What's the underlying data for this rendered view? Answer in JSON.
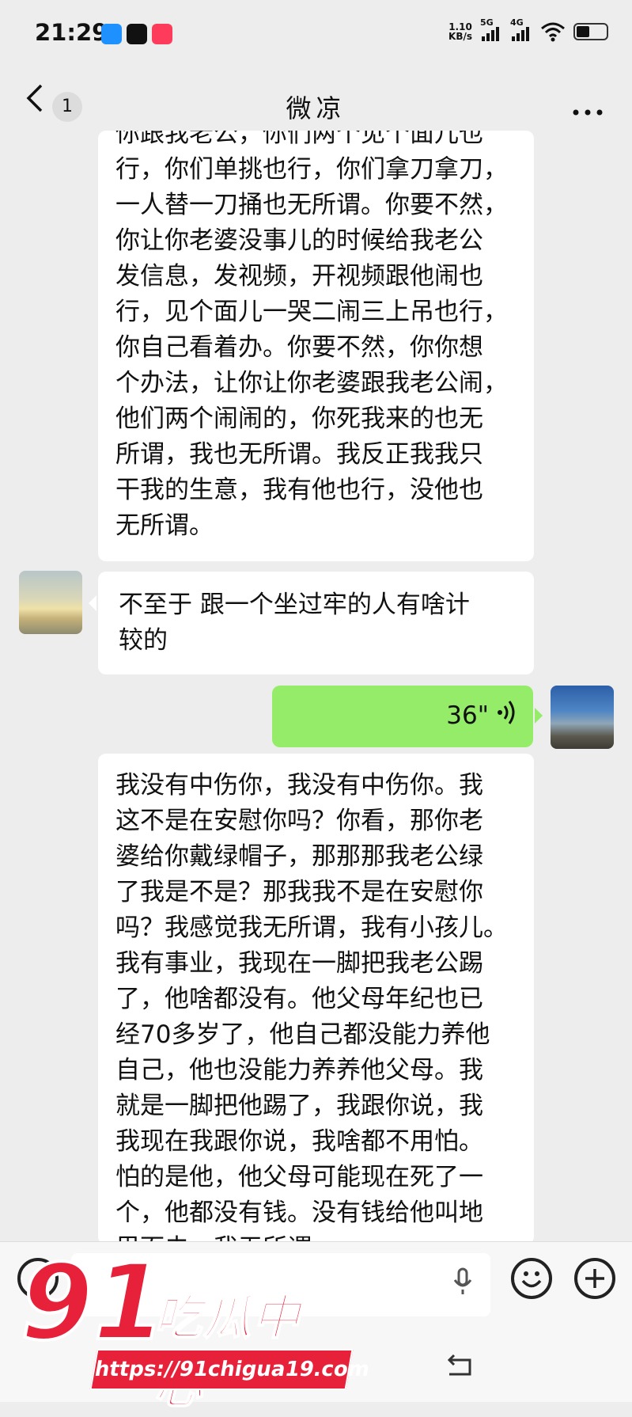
{
  "status_bar": {
    "time": "21:29",
    "net_speed": "1.10",
    "net_unit": "KB/s",
    "sig1": "5G",
    "sig2": "4G"
  },
  "nav": {
    "back_icon": "chevron-left-icon",
    "unread_count": "1",
    "title": "微凉",
    "more_icon": "ellipsis-icon"
  },
  "messages": [
    {
      "side": "left",
      "lines": [
        "你跟我老公，你们两个见个面儿也",
        "行，你们单挑也行，你们拿刀拿刀，",
        "一人替一刀捅也无所谓。你要不然，",
        "你让你老婆没事儿的时候给我老公",
        "发信息，发视频，开视频跟他闹也",
        "行，见个面儿一哭二闹三上吊也行，",
        "你自己看着办。你要不然，你你想",
        "个办法，让你让你老婆跟我老公闹，",
        "他们两个闹闹的，你死我来的也无",
        "所谓，我也无所谓。我反正我我只",
        "干我的生意，我有他也行，没他也",
        "无所谓。"
      ]
    },
    {
      "side": "left",
      "lines": [
        "不至于 跟一个坐过牢的人有啥计",
        "较的"
      ]
    },
    {
      "side": "right",
      "type": "voice",
      "duration": "36\""
    },
    {
      "side": "left",
      "lines": [
        "我没有中伤你，我没有中伤你。我",
        "这不是在安慰你吗？你看，那你老",
        "婆给你戴绿帽子，那那那我老公绿",
        "了我是不是？那我我不是在安慰你",
        "吗？我感觉我无所谓，我有小孩儿。",
        "我有事业，我现在一脚把我老公踢",
        "了，他啥都没有。他父母年纪也已",
        "经70多岁了，他自己都没能力养他",
        "自己，他也没能力养养他父母。我",
        "就是一脚把他踢了，我跟你说，我",
        "我现在我跟你说，我啥都不用怕。",
        "怕的是他，他父母可能现在死了一",
        "个，他都没有钱。没有钱给他叫地",
        "里面去，我无所谓"
      ]
    }
  ],
  "watermark": {
    "num": "91",
    "cn": "吃瓜中心",
    "url": "https://91chigua19.com"
  },
  "colors": {
    "bg": "#ededed",
    "bubble_self": "#95ec69",
    "bubble_other": "#ffffff",
    "watermark": "#e8213a"
  }
}
